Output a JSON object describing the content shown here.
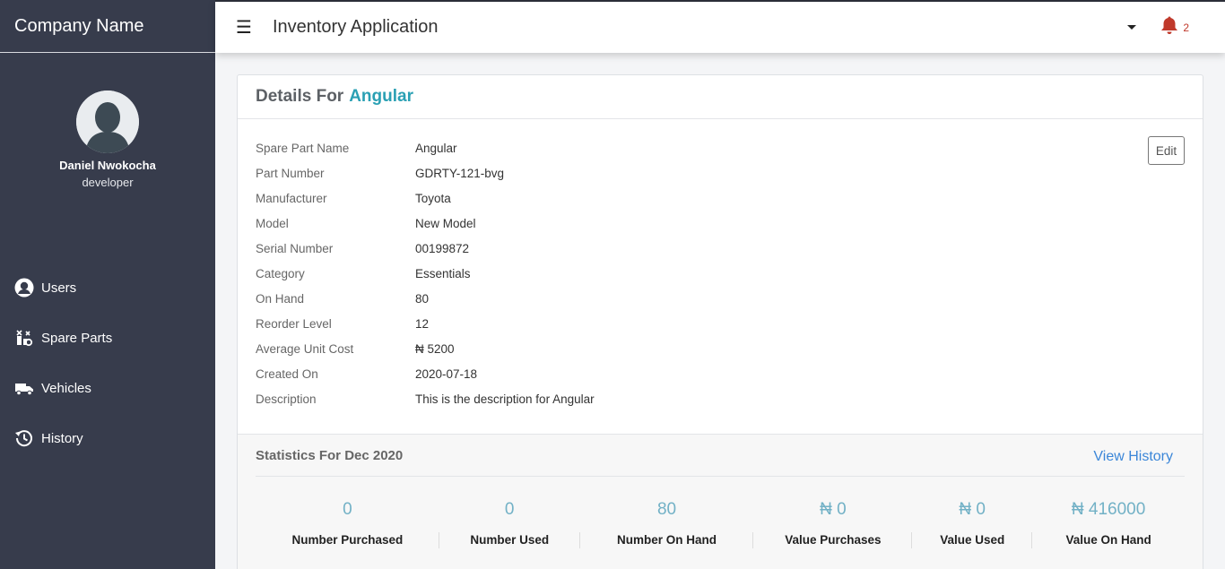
{
  "sidebar": {
    "brand": "Company Name",
    "user_name": "Daniel Nwokocha",
    "user_role": "developer",
    "nav": [
      {
        "label": "Users",
        "icon": "user-circle-icon"
      },
      {
        "label": "Spare Parts",
        "icon": "spare-parts-icon"
      },
      {
        "label": "Vehicles",
        "icon": "truck-icon"
      },
      {
        "label": "History",
        "icon": "history-icon"
      }
    ]
  },
  "topbar": {
    "menu_glyph": "☰",
    "title": "Inventory Application",
    "notification_count": "2"
  },
  "card": {
    "header_prefix": "Details For",
    "header_name": "Angular",
    "edit_label": "Edit",
    "details": [
      {
        "label": "Spare Part Name",
        "value": "Angular"
      },
      {
        "label": "Part Number",
        "value": "GDRTY-121-bvg"
      },
      {
        "label": "Manufacturer",
        "value": "Toyota"
      },
      {
        "label": "Model",
        "value": "New Model"
      },
      {
        "label": "Serial Number",
        "value": "00199872"
      },
      {
        "label": "Category",
        "value": "Essentials"
      },
      {
        "label": "On Hand",
        "value": "80"
      },
      {
        "label": "Reorder Level",
        "value": "12"
      },
      {
        "label": "Average Unit Cost",
        "value": "₦ 5200"
      },
      {
        "label": "Created On",
        "value": "2020-07-18"
      },
      {
        "label": "Description",
        "value": "This is the description for Angular"
      }
    ]
  },
  "stats": {
    "title": "Statistics For Dec 2020",
    "view_history": "View History",
    "items": [
      {
        "value": "0",
        "label": "Number Purchased"
      },
      {
        "value": "0",
        "label": "Number Used"
      },
      {
        "value": "80",
        "label": "Number On Hand"
      },
      {
        "value": "₦ 0",
        "label": "Value Purchases"
      },
      {
        "value": "₦ 0",
        "label": "Value Used"
      },
      {
        "value": "₦ 416000",
        "label": "Value On Hand"
      }
    ]
  },
  "colors": {
    "sidebar_bg": "#373c4c",
    "accent": "#2aa0b4",
    "link": "#3b86d8",
    "bell": "#c0392b",
    "stat_value": "#72b1c6"
  }
}
